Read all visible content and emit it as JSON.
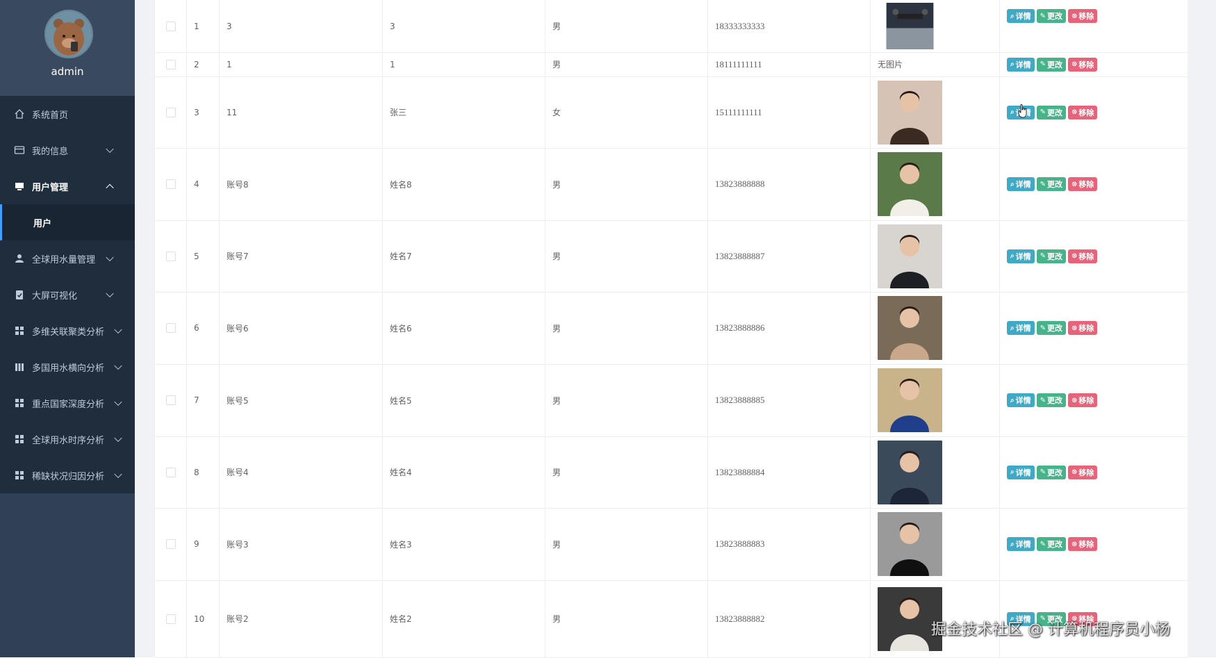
{
  "sidebar": {
    "username": "admin",
    "menu": [
      {
        "label": "系统首页",
        "icon": "home-icon"
      },
      {
        "label": "我的信息",
        "icon": "id-card-icon"
      },
      {
        "label": "用户管理",
        "icon": "monitor-icon"
      },
      {
        "label": "用户",
        "icon": ""
      },
      {
        "label": "全球用水量管理",
        "icon": "user-icon"
      },
      {
        "label": "大屏可视化",
        "icon": "clipboard-icon"
      },
      {
        "label": "多维关联聚类分析",
        "icon": "grid-icon"
      },
      {
        "label": "多国用水横向分析",
        "icon": "bar-icon"
      },
      {
        "label": "重点国家深度分析",
        "icon": "grid-icon"
      },
      {
        "label": "全球用水时序分析",
        "icon": "grid-icon"
      },
      {
        "label": "稀缺状况归因分析",
        "icon": "grid-icon"
      }
    ]
  },
  "table": {
    "rows": [
      {
        "index": "1",
        "account": "3",
        "name": "3",
        "sex": "男",
        "phone": "18333333333",
        "image": "drone-photo",
        "image_text": ""
      },
      {
        "index": "2",
        "account": "1",
        "name": "1",
        "sex": "男",
        "phone": "18111111111",
        "image": "",
        "image_text": "无图片"
      },
      {
        "index": "3",
        "account": "11",
        "name": "张三",
        "sex": "女",
        "phone": "15111111111",
        "image": "portrait-photo",
        "image_text": ""
      },
      {
        "index": "4",
        "account": "账号8",
        "name": "姓名8",
        "sex": "男",
        "phone": "13823888888",
        "image": "portrait-photo",
        "image_text": ""
      },
      {
        "index": "5",
        "account": "账号7",
        "name": "姓名7",
        "sex": "男",
        "phone": "13823888887",
        "image": "portrait-photo",
        "image_text": ""
      },
      {
        "index": "6",
        "account": "账号6",
        "name": "姓名6",
        "sex": "男",
        "phone": "13823888886",
        "image": "portrait-photo",
        "image_text": ""
      },
      {
        "index": "7",
        "account": "账号5",
        "name": "姓名5",
        "sex": "男",
        "phone": "13823888885",
        "image": "portrait-photo",
        "image_text": ""
      },
      {
        "index": "8",
        "account": "账号4",
        "name": "姓名4",
        "sex": "男",
        "phone": "13823888884",
        "image": "portrait-photo",
        "image_text": ""
      },
      {
        "index": "9",
        "account": "账号3",
        "name": "姓名3",
        "sex": "男",
        "phone": "13823888883",
        "image": "portrait-photo",
        "image_text": ""
      },
      {
        "index": "10",
        "account": "账号2",
        "name": "姓名2",
        "sex": "男",
        "phone": "13823888882",
        "image": "portrait-photo",
        "image_text": ""
      }
    ],
    "actions": {
      "detail": "详情",
      "edit": "更改",
      "delete": "移除"
    }
  },
  "watermark": "掘金技术社区 @ 计算机程序员小杨",
  "colors": {
    "sidebar": "#304156",
    "detail": "#40a9c6",
    "edit": "#48b28a",
    "delete": "#e8627a"
  }
}
